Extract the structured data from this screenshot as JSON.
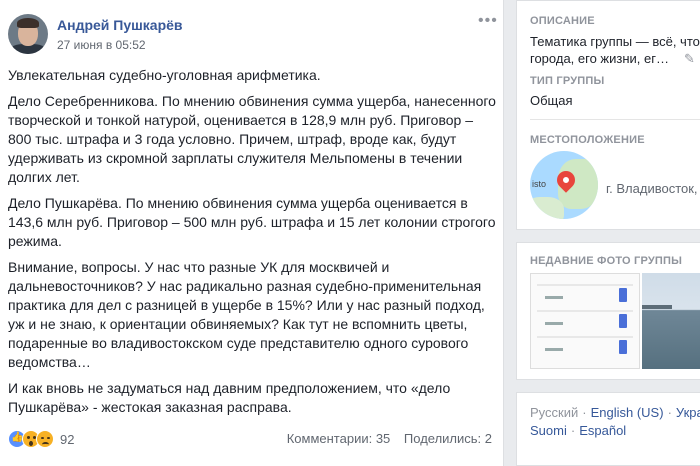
{
  "post": {
    "author": "Андрей Пушкарёв",
    "time": "27 июня в 05:52",
    "paragraphs": [
      "Увлекательная судебно-уголовная арифметика.",
      "Дело Серебренникова. По мнению обвинения сумма ущерба, нанесенного творческой и тонкой натурой, оценивается в 128,9 млн руб. Приговор – 800 тыс. штрафа и 3 года условно. Причем, штраф, вроде как, будут удерживать из скромной зарплаты служителя Мельпомены в течении долгих лет.",
      "Дело Пушкарёва. По мнению обвинения сумма ущерба оценивается в 143,6 млн руб. Приговор – 500 млн руб. штрафа и 15 лет колонии строгого режима.",
      "Внимание, вопросы. У нас что разные УК для москвичей и дальневосточников? У нас радикально разная судебно-применительная практика для дел с разницей в ущербе в 15%? Или у нас разный подход, уж и не знаю, к ориентации обвиняемых? Как тут не вспомнить цветы, подаренные во владивостокском суде представителю одного сурового ведомства…",
      "И как вновь не задуматься над давним предположением, что «дело Пушкарёва» - жестокая заказная расправа."
    ],
    "reactions_count": "92",
    "comments": "Комментарии: 35",
    "shares": "Поделились: 2"
  },
  "sidebar": {
    "description_label": "ОПИСАНИЕ",
    "description_line1": "Тематика группы — всё, что",
    "description_line2": "города, его жизни, ег…",
    "group_type_label": "ТИП ГРУППЫ",
    "group_type_value": "Общая",
    "location_label": "МЕСТОПОЛОЖЕНИЕ",
    "location_value": "г. Владивосток,",
    "map_text": "isto",
    "recent_photos_label": "НЕДАВНИЕ ФОТО ГРУППЫ",
    "languages": [
      "Русский",
      "English (US)",
      "Укра",
      "Suomi",
      "Español"
    ]
  },
  "icons": {
    "more": "more-horizontal-icon",
    "edit": "pencil-icon",
    "map_pin": "map-pin-icon"
  },
  "colors": {
    "link": "#385898",
    "background": "#e9ebee",
    "pin": "#e8453c"
  }
}
